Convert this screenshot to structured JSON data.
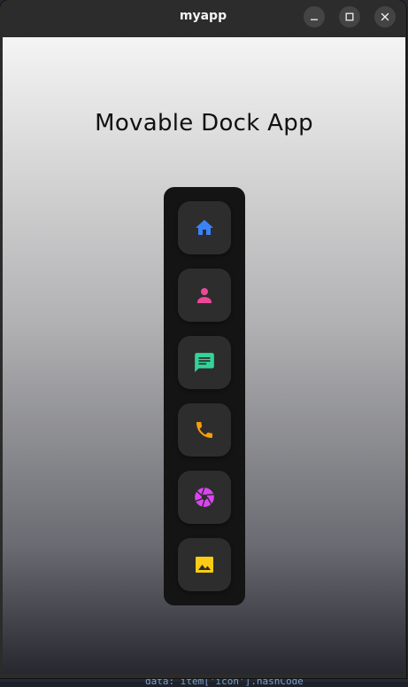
{
  "window": {
    "title": "myapp",
    "controls": {
      "minimize_icon": "minimize-icon",
      "maximize_icon": "maximize-icon",
      "close_icon": "close-icon"
    }
  },
  "app": {
    "title": "Movable Dock App"
  },
  "dock": {
    "items": [
      {
        "icon": "home-icon",
        "color": "#3b82f6"
      },
      {
        "icon": "person-icon",
        "color": "#ec4899"
      },
      {
        "icon": "message-icon",
        "color": "#34d399"
      },
      {
        "icon": "phone-icon",
        "color": "#f59e0b"
      },
      {
        "icon": "camera-aperture-icon",
        "color": "#d946ef"
      },
      {
        "icon": "image-icon",
        "color": "#facc15"
      }
    ]
  },
  "background_snippet": "data: item['icon'].hashCode"
}
